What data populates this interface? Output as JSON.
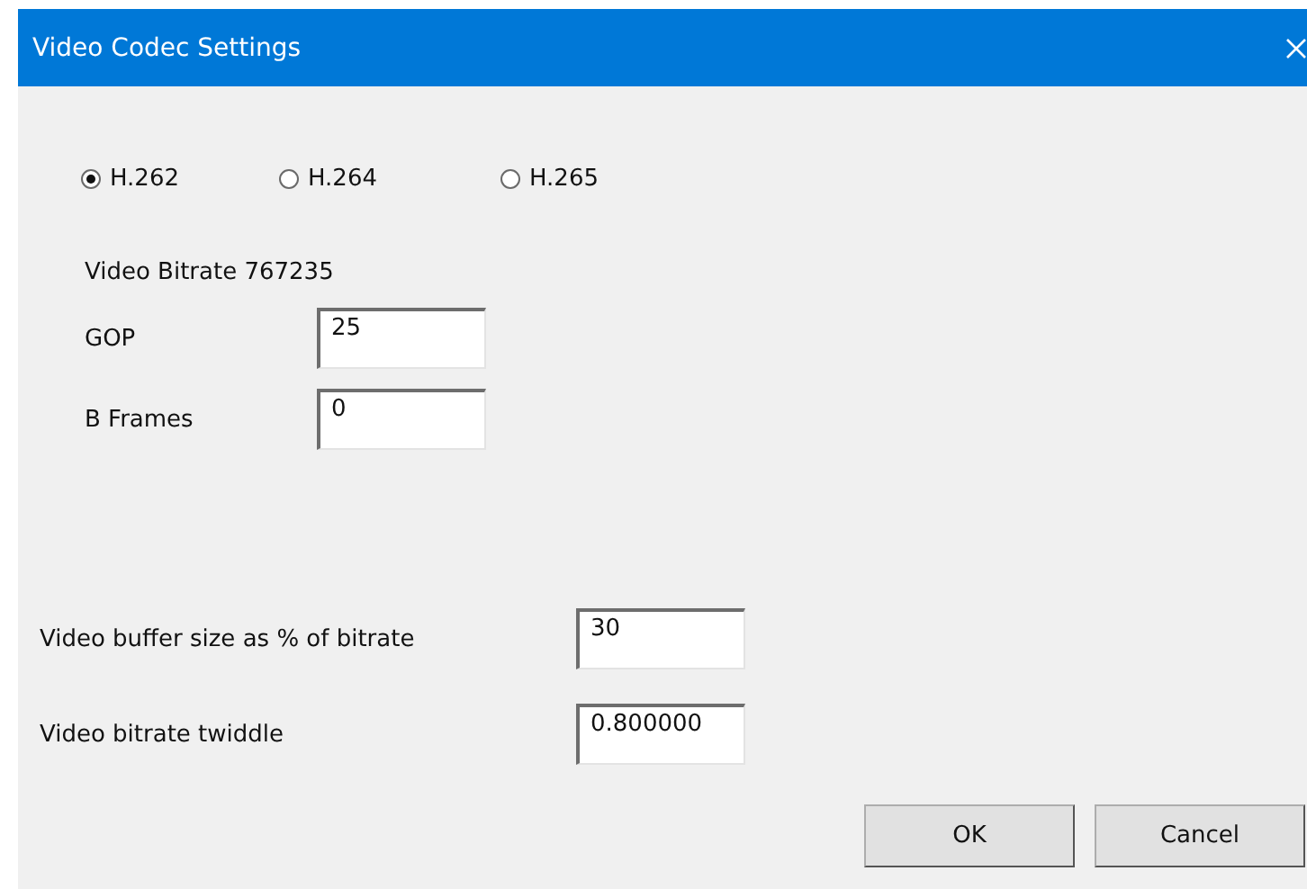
{
  "window": {
    "title": "Video Codec Settings"
  },
  "codecs": [
    {
      "label": "H.262",
      "selected": true
    },
    {
      "label": "H.264",
      "selected": false
    },
    {
      "label": "H.265",
      "selected": false
    }
  ],
  "bitrate_label": "Video Bitrate 767235",
  "codec_fields": [
    {
      "label": "GOP",
      "value": "25"
    },
    {
      "label": "B Frames",
      "value": "0"
    }
  ],
  "buffer_fields": [
    {
      "label": "Video buffer size as % of bitrate",
      "value": "30"
    },
    {
      "label": "Video bitrate twiddle",
      "value": "0.800000"
    }
  ],
  "buttons": [
    "OK",
    "Cancel"
  ]
}
